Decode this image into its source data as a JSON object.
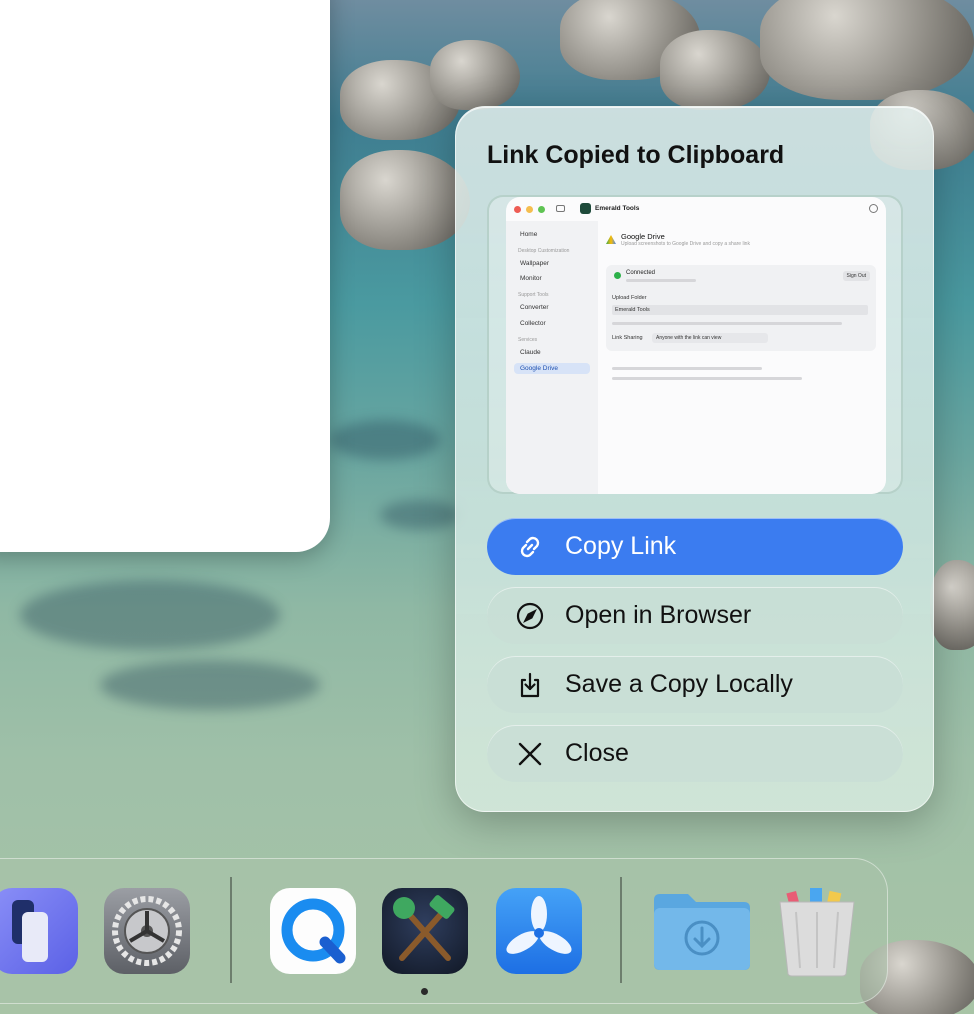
{
  "panel": {
    "title": "Link Copied to Clipboard",
    "preview": {
      "app_title": "Emerald Tools",
      "sidebar": {
        "home": "Home",
        "section_desktop": "Desktop Customization",
        "wallpaper": "Wallpaper",
        "monitor": "Monitor",
        "section_support": "Support Tools",
        "converter": "Converter",
        "collector": "Collector",
        "section_services": "Services",
        "claude": "Claude",
        "google_drive": "Google Drive"
      },
      "main": {
        "title": "Google Drive",
        "subtitle": "Upload screenshots to Google Drive and copy a share link",
        "status": "Connected",
        "sign_out": "Sign Out",
        "upload_folder_label": "Upload Folder",
        "upload_folder_value": "Emerald Tools",
        "link_sharing_label": "Link Sharing",
        "link_sharing_value": "Anyone with the link can view"
      }
    },
    "buttons": [
      {
        "label": "Copy Link",
        "icon": "link-icon"
      },
      {
        "label": "Open in Browser",
        "icon": "compass-icon"
      },
      {
        "label": "Save a Copy Locally",
        "icon": "download-tray-icon"
      },
      {
        "label": "Close",
        "icon": "close-icon"
      }
    ]
  },
  "dock": {
    "apps": [
      {
        "name": "app-remote",
        "icon": "phone-remote-icon"
      },
      {
        "name": "system-settings",
        "icon": "gear-icon"
      },
      {
        "name": "quicktime",
        "icon": "quicktime-icon"
      },
      {
        "name": "emerald-tools",
        "icon": "crossed-hammers-icon"
      },
      {
        "name": "fan-app",
        "icon": "fan-icon"
      },
      {
        "name": "downloads",
        "icon": "downloads-folder-icon"
      },
      {
        "name": "trash",
        "icon": "trash-icon"
      }
    ]
  },
  "colors": {
    "accent": "#3b7cf0",
    "panel_bg": "#dcebe6"
  }
}
